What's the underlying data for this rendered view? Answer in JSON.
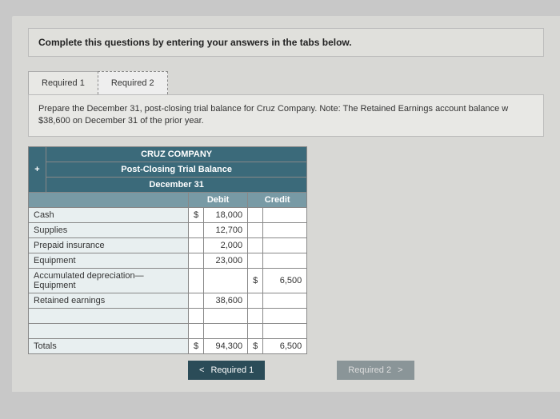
{
  "instruction": "Complete this questions by entering your answers in the tabs below.",
  "tabs": [
    {
      "label": "Required 1"
    },
    {
      "label": "Required 2"
    }
  ],
  "prompt": "Prepare the December 31, post-closing trial balance for Cruz Company. Note: The Retained Earnings account balance w $38,600 on December 31 of the prior year.",
  "trial_balance": {
    "company": "CRUZ COMPANY",
    "title": "Post-Closing Trial Balance",
    "date": "December 31",
    "col_debit": "Debit",
    "col_credit": "Credit",
    "rows": [
      {
        "account": "Cash",
        "debit_sym": "$",
        "debit": "18,000",
        "credit_sym": "",
        "credit": ""
      },
      {
        "account": "Supplies",
        "debit_sym": "",
        "debit": "12,700",
        "credit_sym": "",
        "credit": ""
      },
      {
        "account": "Prepaid insurance",
        "debit_sym": "",
        "debit": "2,000",
        "credit_sym": "",
        "credit": ""
      },
      {
        "account": "Equipment",
        "debit_sym": "",
        "debit": "23,000",
        "credit_sym": "",
        "credit": ""
      },
      {
        "account": "Accumulated depreciation—Equipment",
        "debit_sym": "",
        "debit": "",
        "credit_sym": "$",
        "credit": "6,500"
      },
      {
        "account": "Retained earnings",
        "debit_sym": "",
        "debit": "38,600",
        "credit_sym": "",
        "credit": ""
      },
      {
        "account": "",
        "debit_sym": "",
        "debit": "",
        "credit_sym": "",
        "credit": ""
      },
      {
        "account": "",
        "debit_sym": "",
        "debit": "",
        "credit_sym": "",
        "credit": ""
      }
    ],
    "totals": {
      "label": "Totals",
      "debit_sym": "$",
      "debit": "94,300",
      "credit_sym": "$",
      "credit": "6,500"
    }
  },
  "nav": {
    "prev": "Required 1",
    "next": "Required 2"
  },
  "icons": {
    "plus": "+",
    "chev_left": "<",
    "chev_right": ">"
  }
}
